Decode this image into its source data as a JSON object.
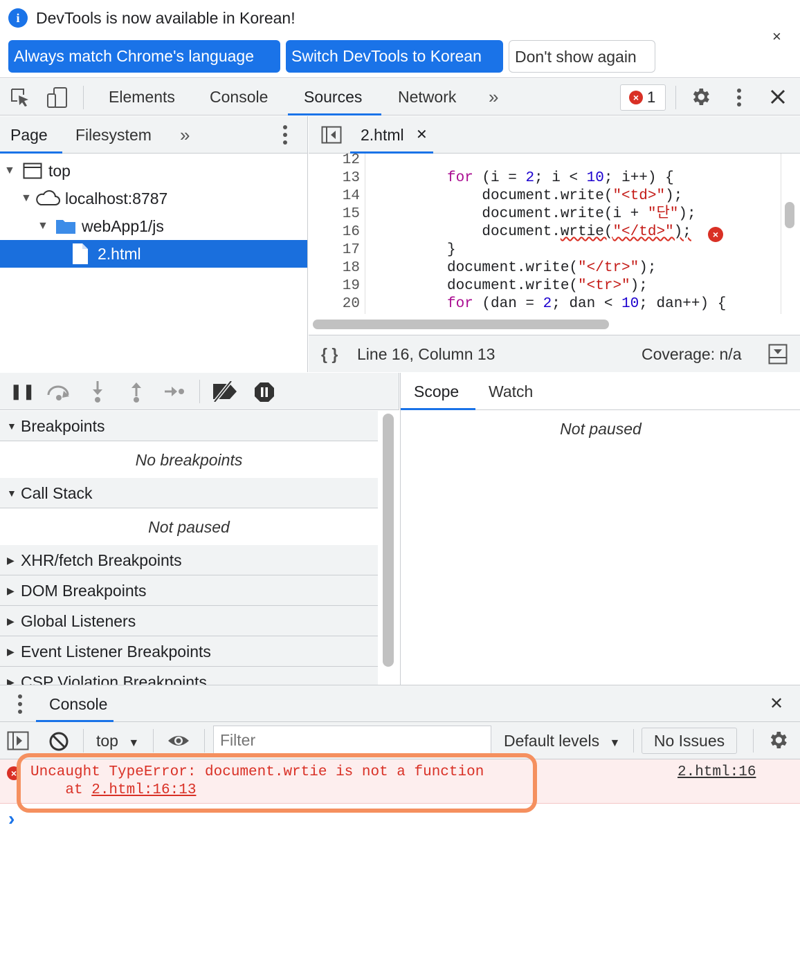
{
  "info_bar": {
    "message": "DevTools is now available in Korean!",
    "buttons": [
      "Always match Chrome's language",
      "Switch DevTools to Korean",
      "Don't show again"
    ],
    "close_glyph": "×"
  },
  "main_toolbar": {
    "tabs": [
      "Elements",
      "Console",
      "Sources",
      "Network"
    ],
    "active_tab": "Sources",
    "more_glyph": "»",
    "error_count": "1"
  },
  "navigator": {
    "tabs": [
      "Page",
      "Filesystem"
    ],
    "more_glyph": "»",
    "tree": [
      "top",
      "localhost:8787",
      "webApp1/js",
      "2.html"
    ]
  },
  "editor": {
    "tab_label": "2.html",
    "tab_close": "✕",
    "line_numbers": [
      "12",
      "13",
      "14",
      "15",
      "16",
      "17",
      "18",
      "19",
      "20"
    ],
    "lines": [
      [],
      [
        {
          "t": "for",
          "c": "kw"
        },
        {
          "t": " (i = ",
          "c": ""
        },
        {
          "t": "2",
          "c": "num"
        },
        {
          "t": "; i < ",
          "c": ""
        },
        {
          "t": "10",
          "c": "num"
        },
        {
          "t": "; i++) {",
          "c": ""
        }
      ],
      [
        {
          "t": "    document.write(",
          "c": ""
        },
        {
          "t": "\"<td>\"",
          "c": "str"
        },
        {
          "t": ");",
          "c": ""
        }
      ],
      [
        {
          "t": "    document.write(i + ",
          "c": ""
        },
        {
          "t": "\"단\"",
          "c": "str"
        },
        {
          "t": ");",
          "c": ""
        }
      ],
      [
        {
          "t": "    document.",
          "c": ""
        },
        {
          "t": "wrtie(",
          "c": "squiggle"
        },
        {
          "t": "\"</td>\"",
          "c": "str squiggle"
        },
        {
          "t": ");",
          "c": "squiggle"
        }
      ],
      [
        {
          "t": "}",
          "c": ""
        }
      ],
      [
        {
          "t": "document.write(",
          "c": ""
        },
        {
          "t": "\"</tr>\"",
          "c": "str"
        },
        {
          "t": ");",
          "c": ""
        }
      ],
      [
        {
          "t": "document.write(",
          "c": ""
        },
        {
          "t": "\"<tr>\"",
          "c": "str"
        },
        {
          "t": ");",
          "c": ""
        }
      ],
      [
        {
          "t": "for",
          "c": "kw"
        },
        {
          "t": " (dan = ",
          "c": ""
        },
        {
          "t": "2",
          "c": "num"
        },
        {
          "t": "; dan < ",
          "c": ""
        },
        {
          "t": "10",
          "c": "num"
        },
        {
          "t": "; dan++) {",
          "c": ""
        }
      ]
    ],
    "footer": {
      "format_glyph": "{ }",
      "position": "Line 16, Column 13",
      "coverage": "Coverage: n/a"
    }
  },
  "debugger": {
    "sections": [
      {
        "title": "Breakpoints",
        "expanded": true,
        "body": "No breakpoints"
      },
      {
        "title": "Call Stack",
        "expanded": true,
        "body": "Not paused"
      },
      {
        "title": "XHR/fetch Breakpoints",
        "expanded": false
      },
      {
        "title": "DOM Breakpoints",
        "expanded": false
      },
      {
        "title": "Global Listeners",
        "expanded": false
      },
      {
        "title": "Event Listener Breakpoints",
        "expanded": false
      },
      {
        "title": "CSP Violation Breakpoints",
        "expanded": false
      }
    ]
  },
  "scope_panel": {
    "tabs": [
      "Scope",
      "Watch"
    ],
    "message": "Not paused"
  },
  "console_drawer": {
    "tab": "Console",
    "close_glyph": "✕",
    "context": "top",
    "filter_placeholder": "Filter",
    "levels": "Default levels",
    "issues": "No Issues",
    "error": {
      "message": "Uncaught TypeError: document.wrtie is not a function",
      "stack_prefix": "    at ",
      "stack_link": "2.html:16:13",
      "source_link": "2.html:16"
    },
    "prompt_glyph": "›"
  }
}
